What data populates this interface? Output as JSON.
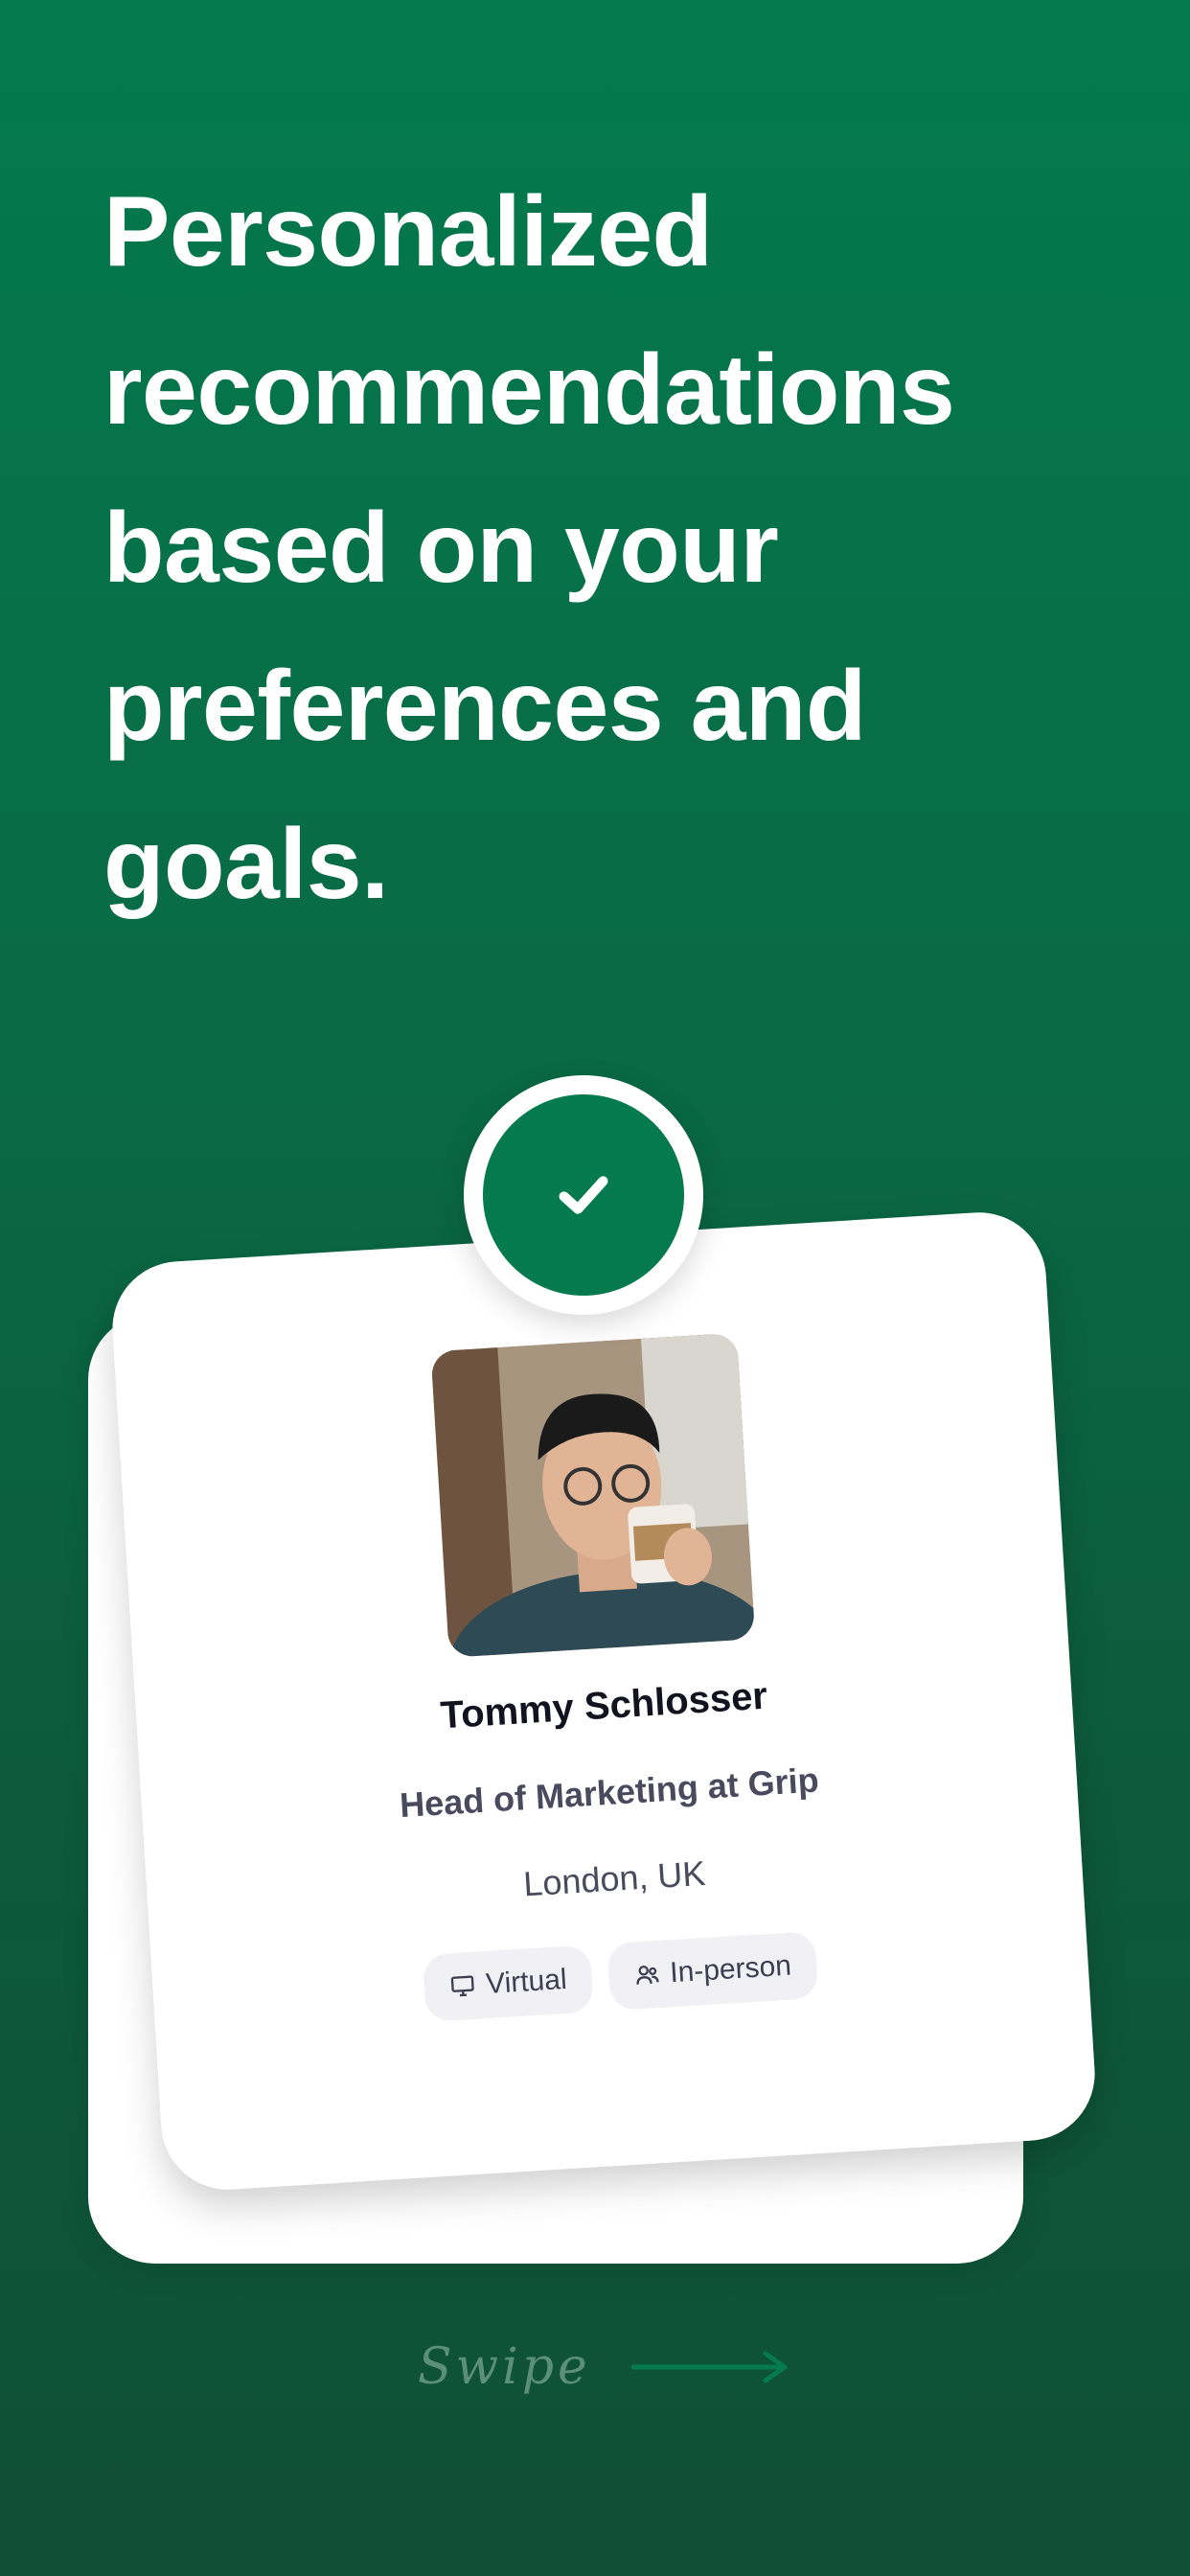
{
  "headline": "Personalized recommendations based on your preferences and goals.",
  "card": {
    "name": "Tommy Schlosser",
    "role": "Head of Marketing at Grip",
    "location": "London, UK",
    "tags": [
      {
        "label": "Virtual",
        "icon": "monitor-icon"
      },
      {
        "label": "In-person",
        "icon": "people-icon"
      }
    ]
  },
  "check_icon": "check-icon",
  "swipe": {
    "label": "Swipe",
    "icon": "arrow-right-icon"
  },
  "colors": {
    "brand_green": "#047a4e",
    "background_dark": "#0f4f36",
    "text_dark": "#13131f",
    "text_muted": "#494a5e",
    "tag_bg": "#f0f0f5"
  }
}
